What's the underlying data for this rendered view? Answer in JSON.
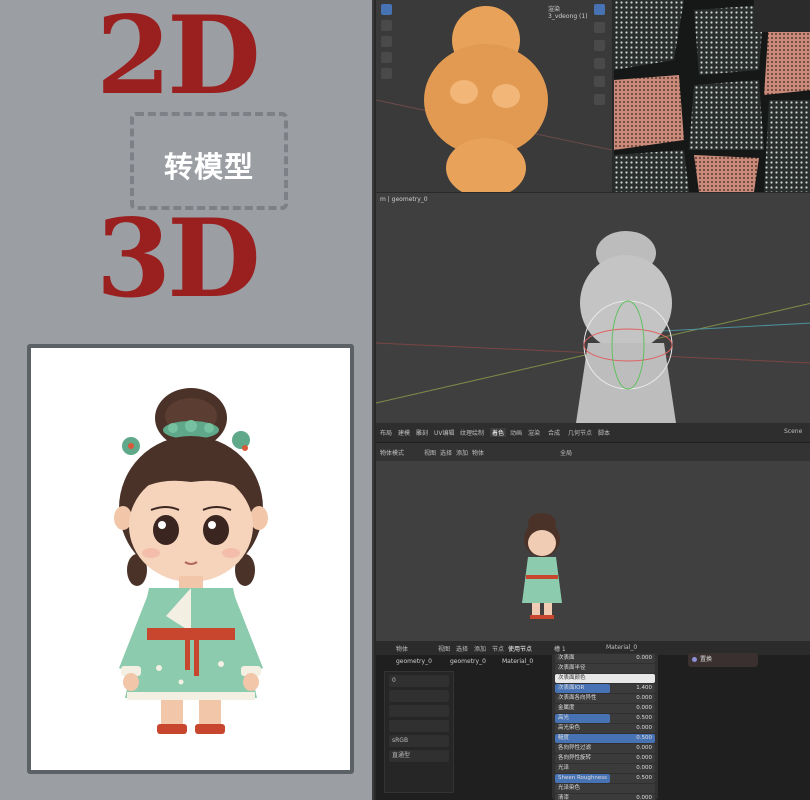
{
  "promo": {
    "top_text": "2D",
    "middle_text": "转模型",
    "bottom_text": "3D"
  },
  "viewport_top": {
    "tab_label": "3_vdeong (1)",
    "panel_label": "渲染"
  },
  "viewport_mid": {
    "header": "m | geometry_0"
  },
  "menubar": {
    "tabs": [
      "布局",
      "建模",
      "雕刻",
      "UV编辑",
      "纹理绘制",
      "着色",
      "动画",
      "渲染",
      "合成",
      "几何节点",
      "脚本"
    ],
    "scene_label": "Scene"
  },
  "viewport_bottom": {
    "mode": "物体模式",
    "menus": [
      "视图",
      "选择",
      "添加",
      "物体"
    ],
    "transform": "全局"
  },
  "node_editor": {
    "header_items": [
      "物体",
      "视图",
      "选择",
      "添加",
      "节点"
    ],
    "use_nodes_label": "使用节点",
    "slot_label": "槽 1",
    "material_name": "Material_0",
    "breadcrumb": [
      "geometry_0",
      "geometry_0",
      "Material_0"
    ],
    "left_panel_rows": [
      "0",
      "",
      "",
      "",
      "sRGB",
      "直通型"
    ],
    "output_node": "置换",
    "bsdf_rows": [
      {
        "label": "次表面",
        "value": "0.000",
        "style": "plain"
      },
      {
        "label": "次表面半径",
        "value": "",
        "style": "plain"
      },
      {
        "label": "次表面颜色",
        "value": "",
        "style": "white"
      },
      {
        "label": "次表面IOR",
        "value": "1.400",
        "style": "half"
      },
      {
        "label": "次表面各向异性",
        "value": "0.000",
        "style": "plain"
      },
      {
        "label": "金属度",
        "value": "0.000",
        "style": "plain"
      },
      {
        "label": "高光",
        "value": "0.500",
        "style": "half"
      },
      {
        "label": "高光染色",
        "value": "0.000",
        "style": "plain"
      },
      {
        "label": "糙度",
        "value": "0.500",
        "style": "blue"
      },
      {
        "label": "各向异性过滤",
        "value": "0.000",
        "style": "plain"
      },
      {
        "label": "各向异性旋转",
        "value": "0.000",
        "style": "plain"
      },
      {
        "label": "光泽",
        "value": "0.000",
        "style": "plain"
      },
      {
        "label": "Sheen Roughness",
        "value": "0.500",
        "style": "half"
      },
      {
        "label": "光泽染色",
        "value": "",
        "style": "plain"
      },
      {
        "label": "清漆",
        "value": "0.000",
        "style": "plain"
      }
    ]
  },
  "colors": {
    "promo_red": "#9a1f1f",
    "panel_gray": "#9b9fa4",
    "blender_dark": "#2a2a2a",
    "blender_accent": "#4772b3",
    "orange_mesh": "#e8a25a"
  }
}
